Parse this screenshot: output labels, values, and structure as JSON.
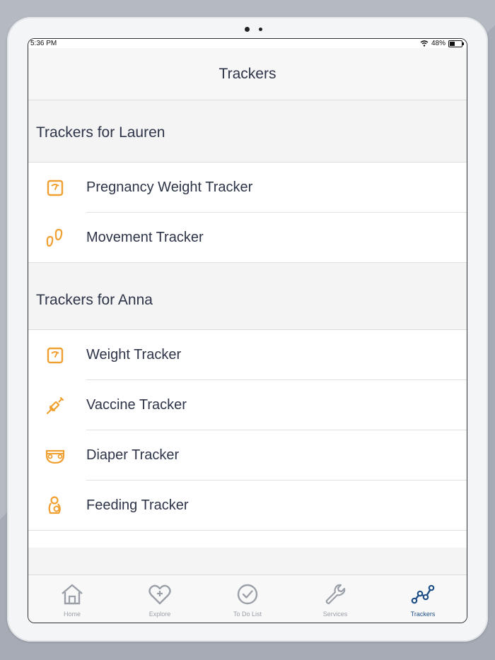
{
  "status_bar": {
    "time": "5:36 PM",
    "battery": "48%"
  },
  "nav": {
    "title": "Trackers"
  },
  "sections": [
    {
      "title": "Trackers for Lauren",
      "items": [
        {
          "label": "Pregnancy Weight Tracker",
          "icon": "scale-icon"
        },
        {
          "label": "Movement Tracker",
          "icon": "footprints-icon"
        }
      ]
    },
    {
      "title": "Trackers for Anna",
      "items": [
        {
          "label": "Weight Tracker",
          "icon": "scale-icon"
        },
        {
          "label": "Vaccine Tracker",
          "icon": "syringe-icon"
        },
        {
          "label": "Diaper Tracker",
          "icon": "diaper-icon"
        },
        {
          "label": "Feeding Tracker",
          "icon": "feeding-icon"
        }
      ]
    }
  ],
  "tabs": [
    {
      "label": "Home",
      "icon": "home-icon",
      "active": false
    },
    {
      "label": "Explore",
      "icon": "heart-plus-icon",
      "active": false
    },
    {
      "label": "To Do List",
      "icon": "check-circle-icon",
      "active": false
    },
    {
      "label": "Services",
      "icon": "wrench-icon",
      "active": false
    },
    {
      "label": "Trackers",
      "icon": "graph-nodes-icon",
      "active": true
    }
  ],
  "colors": {
    "accent_orange": "#f0a030",
    "active_tab": "#1f4f86",
    "inactive_tab": "#9ba0a8",
    "text": "#2e3448"
  }
}
